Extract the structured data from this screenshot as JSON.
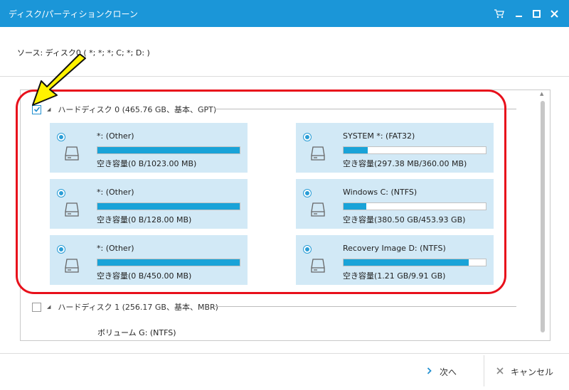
{
  "window": {
    "title": "ディスク/パーティションクローン",
    "controls": [
      "cart-icon",
      "minimize-icon",
      "maximize-icon",
      "close-icon"
    ]
  },
  "source_label": "ソース:   ディスク0 ( *; *; *; C; *; D: )",
  "disk0": {
    "label": "ハードディスク 0 (465.76 GB、基本、GPT)",
    "checked": true,
    "partitions": [
      {
        "name": "*: (Other)",
        "free": "空き容量(0 B/1023.00 MB)",
        "used_fraction": 1.0
      },
      {
        "name": "SYSTEM *: (FAT32)",
        "free": "空き容量(297.38 MB/360.00 MB)",
        "used_fraction": 0.17
      },
      {
        "name": "*: (Other)",
        "free": "空き容量(0 B/128.00 MB)",
        "used_fraction": 1.0
      },
      {
        "name": "Windows C: (NTFS)",
        "free": "空き容量(380.50 GB/453.93 GB)",
        "used_fraction": 0.16
      },
      {
        "name": "*: (Other)",
        "free": "空き容量(0 B/450.00 MB)",
        "used_fraction": 1.0
      },
      {
        "name": "Recovery Image D: (NTFS)",
        "free": "空き容量(1.21 GB/9.91 GB)",
        "used_fraction": 0.88
      }
    ]
  },
  "disk1": {
    "label": "ハードディスク 1 (256.17 GB、基本、MBR)",
    "checked": false,
    "volume": "ボリューム G: (NTFS)"
  },
  "buttons": {
    "next": "次へ",
    "cancel": "キャンセル"
  },
  "colors": {
    "titlebar": "#1b96d8",
    "partition_bg": "#d2e9f6",
    "bar_fill": "#19a3d8",
    "highlight": "#e8101b",
    "arrow": "#fff200"
  }
}
